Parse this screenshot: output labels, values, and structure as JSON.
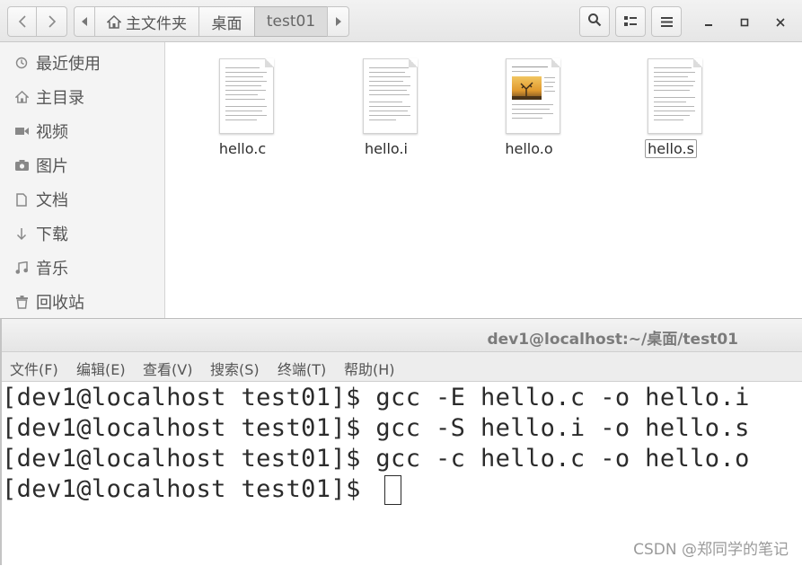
{
  "file_manager": {
    "breadcrumb": {
      "home_label": "主文件夹",
      "desktop_label": "桌面",
      "current_label": "test01"
    },
    "sidebar": {
      "items": [
        {
          "label": "最近使用",
          "icon": "clock-icon"
        },
        {
          "label": "主目录",
          "icon": "home-icon"
        },
        {
          "label": "视频",
          "icon": "video-icon"
        },
        {
          "label": "图片",
          "icon": "camera-icon"
        },
        {
          "label": "文档",
          "icon": "document-icon"
        },
        {
          "label": "下载",
          "icon": "download-icon"
        },
        {
          "label": "音乐",
          "icon": "music-icon"
        },
        {
          "label": "回收站",
          "icon": "trash-icon"
        }
      ]
    },
    "files": [
      {
        "name": "hello.c",
        "thumbnail": "text-document"
      },
      {
        "name": "hello.i",
        "thumbnail": "text-document"
      },
      {
        "name": "hello.o",
        "thumbnail": "image-document"
      },
      {
        "name": "hello.s",
        "thumbnail": "text-document",
        "selected": true
      }
    ]
  },
  "terminal": {
    "title": "dev1@localhost:~/桌面/test01",
    "menu": [
      "文件(F)",
      "编辑(E)",
      "查看(V)",
      "搜索(S)",
      "终端(T)",
      "帮助(H)"
    ],
    "lines": [
      "[dev1@localhost test01]$ gcc -E hello.c -o hello.i",
      "[dev1@localhost test01]$ gcc -S hello.i -o hello.s",
      "[dev1@localhost test01]$ gcc -c hello.c -o hello.o",
      "[dev1@localhost test01]$ "
    ]
  },
  "watermark": "CSDN @郑同学的笔记"
}
